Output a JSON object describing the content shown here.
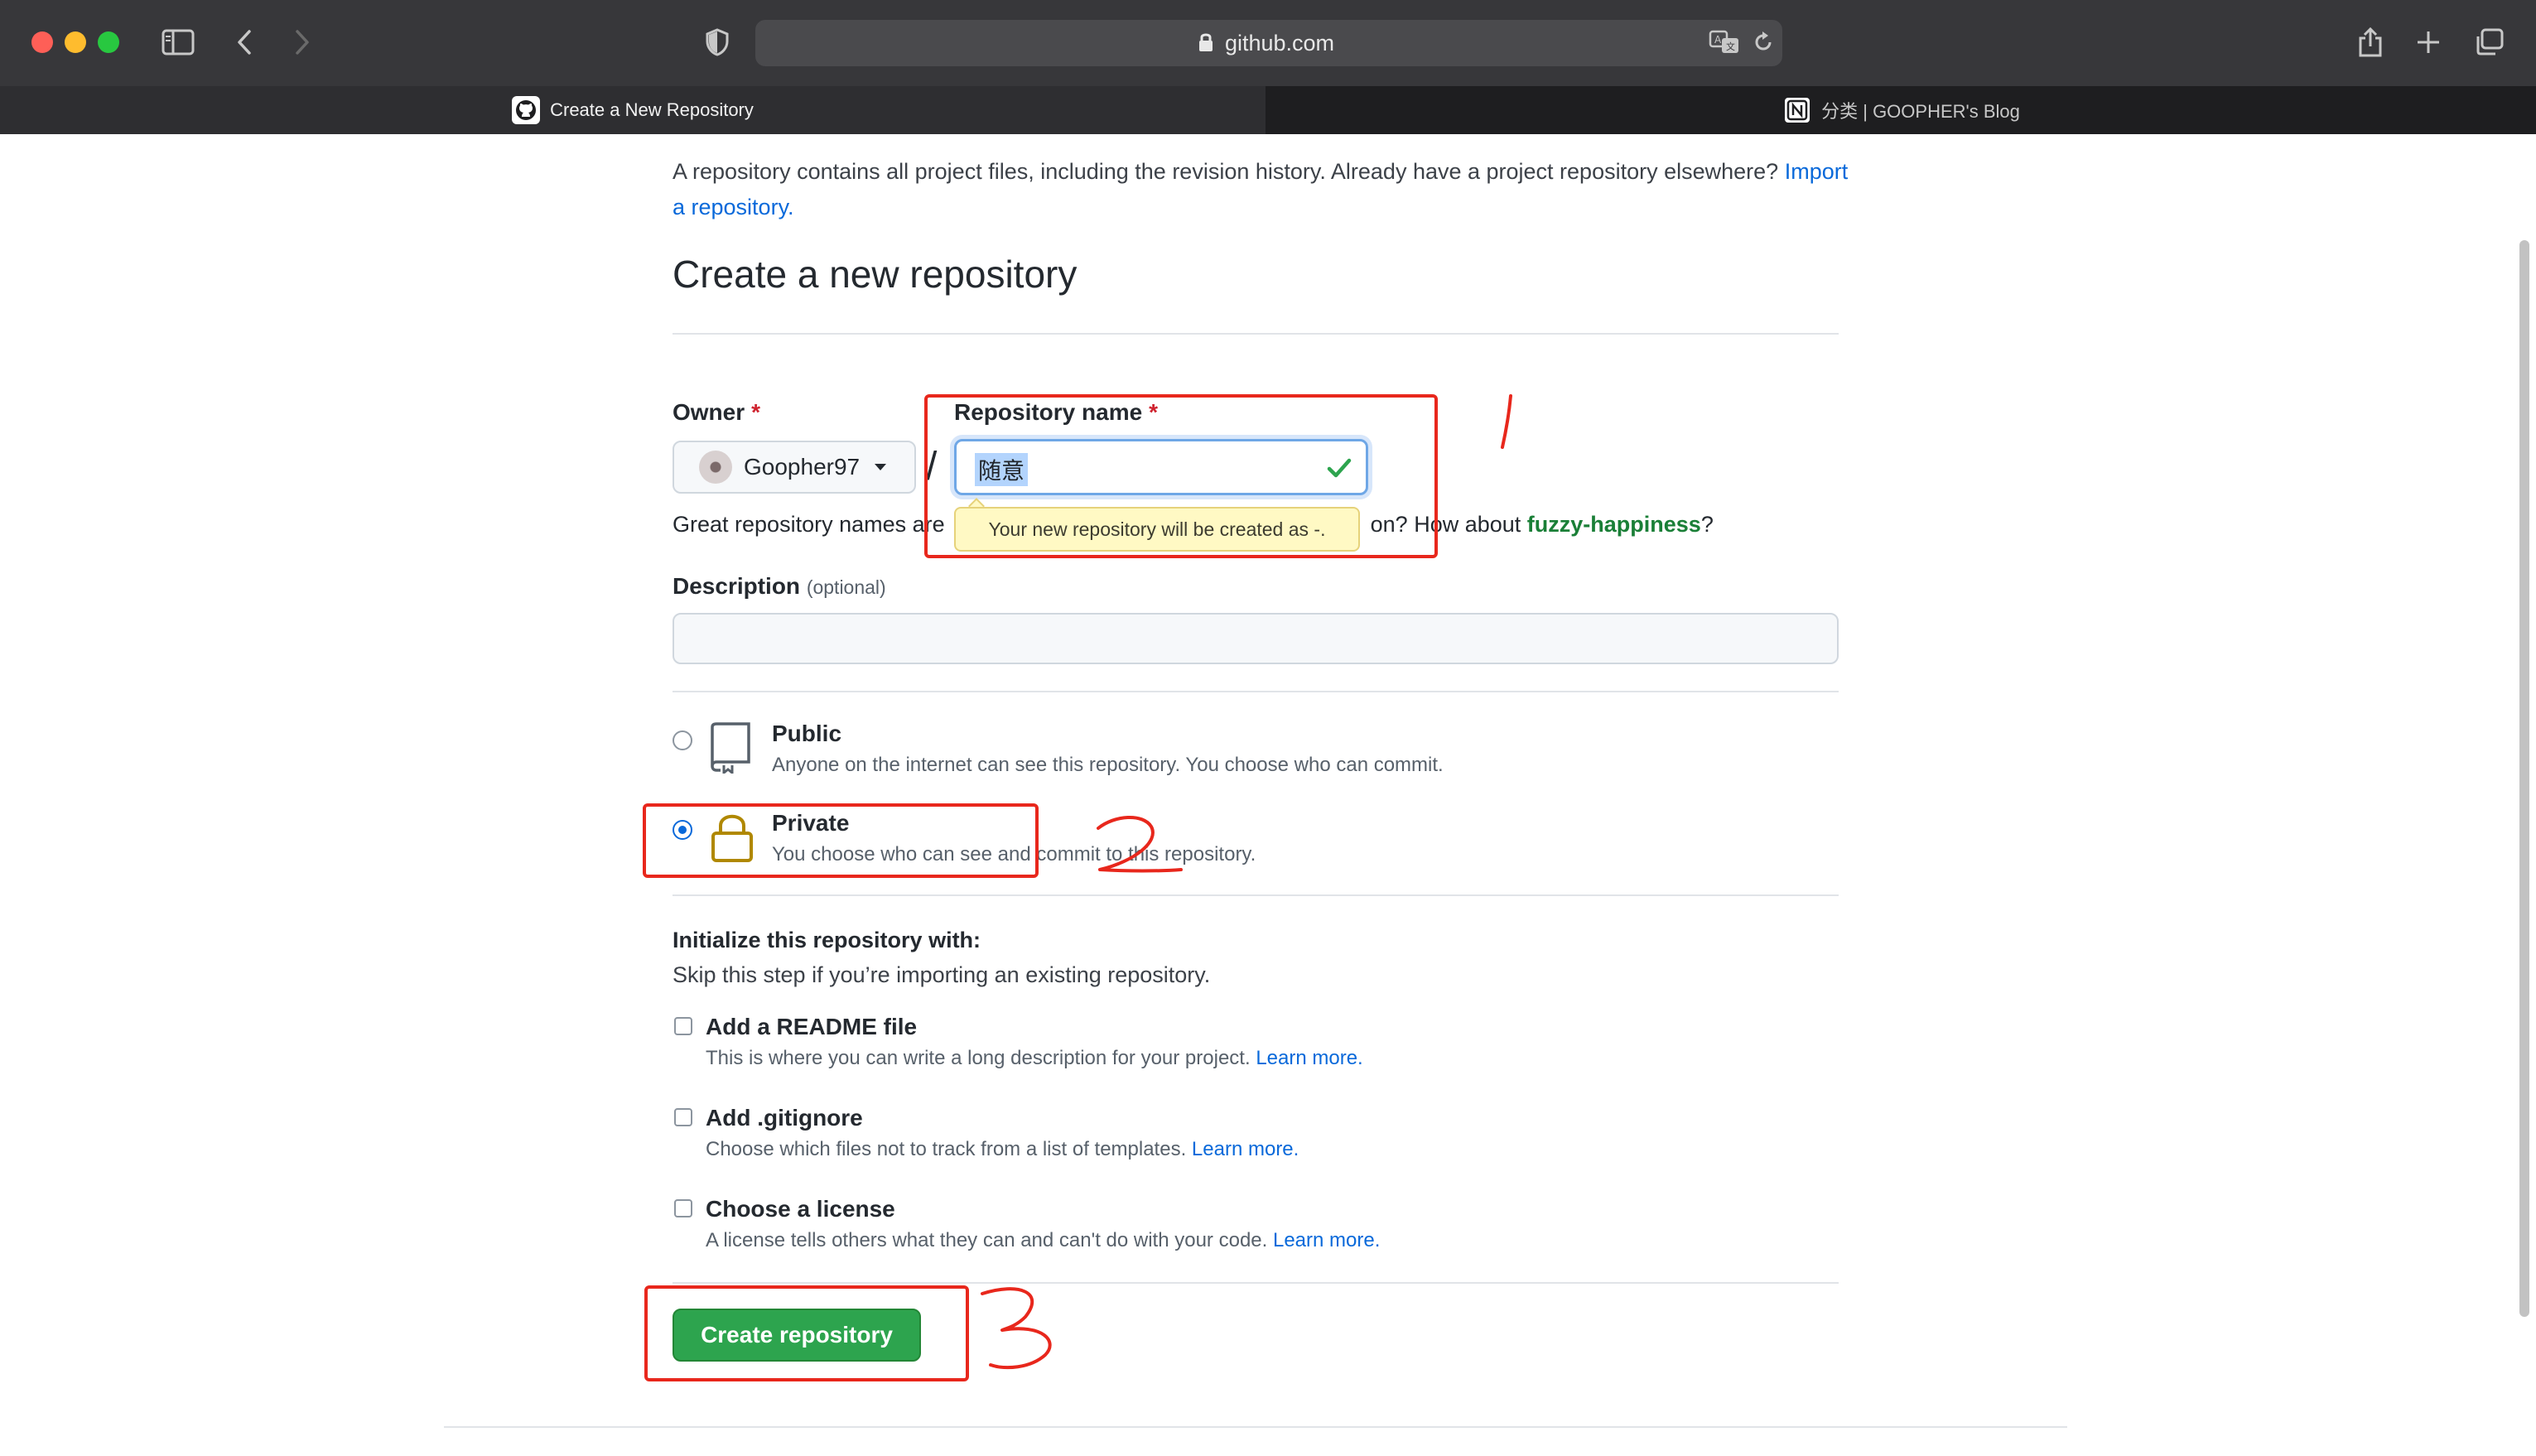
{
  "browser": {
    "url": "github.com",
    "tabs": [
      {
        "label": "Create a New Repository",
        "active": true
      },
      {
        "label": "分类 | GOOPHER's Blog",
        "active": false
      }
    ]
  },
  "page": {
    "intro_text": "A repository contains all project files, including the revision history. Already have a project repository elsewhere?",
    "import_link": "Import a repository.",
    "title": "Create a new repository",
    "owner": {
      "label": "Owner",
      "required_mark": "*",
      "value": "Goopher97"
    },
    "slash": "/",
    "repo_name": {
      "label": "Repository name",
      "required_mark": "*",
      "value": "随意"
    },
    "tooltip": "Your new repository will be created as -.",
    "naming_hint": {
      "prefix": "Great repository names are",
      "middle": "on? How about",
      "suggestion": "fuzzy-happiness",
      "suffix": "?"
    },
    "description": {
      "label": "Description",
      "optional": "(optional)",
      "value": ""
    },
    "visibility": [
      {
        "title": "Public",
        "desc": "Anyone on the internet can see this repository. You choose who can commit.",
        "selected": false,
        "icon": "repo-icon"
      },
      {
        "title": "Private",
        "desc": "You choose who can see and commit to this repository.",
        "selected": true,
        "icon": "lock-icon"
      }
    ],
    "init": {
      "heading": "Initialize this repository with:",
      "subheading": "Skip this step if you’re importing an existing repository.",
      "options": [
        {
          "title": "Add a README file",
          "desc": "This is where you can write a long description for your project.",
          "link": "Learn more."
        },
        {
          "title": "Add .gitignore",
          "desc": "Choose which files not to track from a list of templates.",
          "link": "Learn more."
        },
        {
          "title": "Choose a license",
          "desc": "A license tells others what they can and can't do with your code.",
          "link": "Learn more."
        }
      ]
    },
    "create_button": "Create repository"
  },
  "annotations": {
    "marks": [
      "1",
      "2",
      "3"
    ],
    "color": "#e8271c"
  },
  "colors": {
    "primary_button": "#2da44e",
    "link": "#0969da",
    "suggestion": "#1a7f37",
    "required": "#cf222e"
  }
}
